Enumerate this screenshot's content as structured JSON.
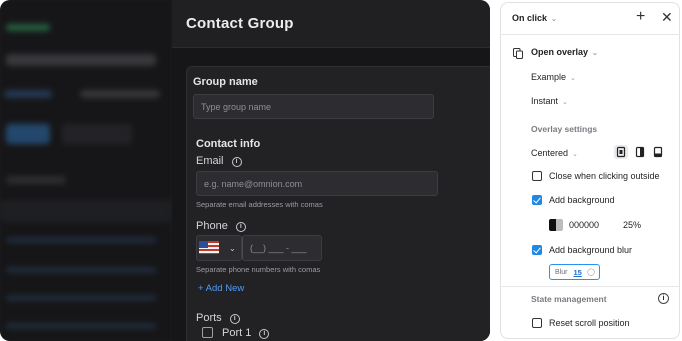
{
  "modal": {
    "title": "Contact Group",
    "group_name": {
      "label": "Group name",
      "placeholder": "Type group name"
    },
    "contact_info": {
      "label": "Contact info"
    },
    "email": {
      "label": "Email",
      "placeholder": "e.g. name@omnion.com",
      "hint": "Separate email addresses with comas"
    },
    "phone": {
      "label": "Phone",
      "placeholder": "(__) ___ - ___",
      "hint": "Separate phone numbers with comas",
      "country_flag": "us-flag-icon"
    },
    "add_new": "+ Add New",
    "ports": {
      "label": "Ports",
      "items": [
        {
          "label": "Port 1",
          "checked": false
        }
      ]
    }
  },
  "panel": {
    "trigger": "On click",
    "action": "Open overlay",
    "destination": "Example",
    "animation": "Instant",
    "overlay_settings": {
      "heading": "Overlay settings",
      "position": "Centered",
      "close_when_clicking_outside": {
        "label": "Close when clicking outside",
        "checked": false
      },
      "add_background": {
        "label": "Add background",
        "checked": true,
        "color": "000000",
        "opacity": "25%"
      },
      "add_background_blur": {
        "label": "Add background blur",
        "checked": true,
        "blur_label": "Blur",
        "blur_value": "15"
      }
    },
    "state_management": {
      "heading": "State management",
      "reset_scroll_position": {
        "label": "Reset scroll position",
        "checked": false
      }
    }
  },
  "colors": {
    "accent": "#1e88e5",
    "canvas_bg": "#1b1b1d",
    "input_bg": "#2d2d31"
  }
}
